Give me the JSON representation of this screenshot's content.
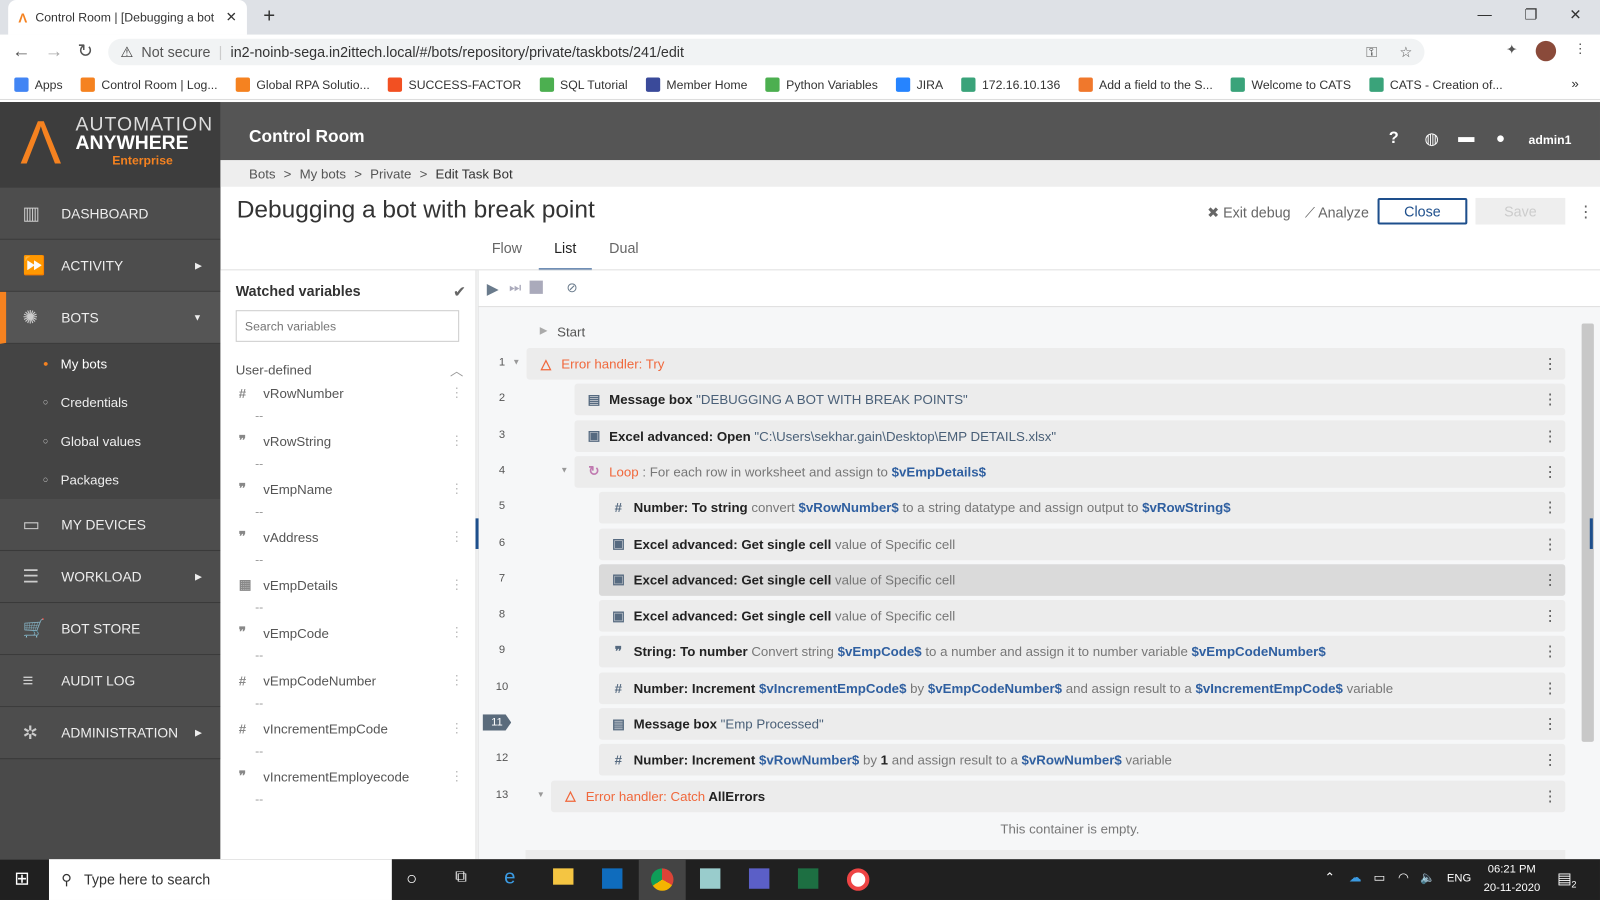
{
  "browser": {
    "tab_title": "Control Room | [Debugging a bot",
    "url_warning": "Not secure",
    "url": "in2-noinb-sega.in2ittech.local/#/bots/repository/private/taskbots/241/edit",
    "bookmarks": [
      {
        "label": "Apps",
        "color": "#4285f4"
      },
      {
        "label": "Control Room | Log...",
        "color": "#f58220"
      },
      {
        "label": "Global RPA Solutio...",
        "color": "#f58220"
      },
      {
        "label": "SUCCESS-FACTOR",
        "color": "#f25022"
      },
      {
        "label": "SQL Tutorial",
        "color": "#4caf50"
      },
      {
        "label": "Member Home",
        "color": "#3a4a9a"
      },
      {
        "label": "Python Variables",
        "color": "#4caf50"
      },
      {
        "label": "JIRA",
        "color": "#2684ff"
      },
      {
        "label": "172.16.10.136",
        "color": "#3aa37a"
      },
      {
        "label": "Add a field to the S...",
        "color": "#f0782c"
      },
      {
        "label": "Welcome to CATS",
        "color": "#3aa37a"
      },
      {
        "label": "CATS - Creation of...",
        "color": "#3aa37a"
      }
    ]
  },
  "app": {
    "logo_line1": "AUTOMATION",
    "logo_line2": "ANYWHERE",
    "logo_line3": "Enterprise",
    "header_title": "Control Room",
    "user": "admin1"
  },
  "nav": [
    {
      "label": "DASHBOARD",
      "icon": "dashboard-icon",
      "glyph": "▥"
    },
    {
      "label": "ACTIVITY",
      "icon": "activity-icon",
      "glyph": "⏩",
      "arrow": "▶"
    },
    {
      "label": "BOTS",
      "icon": "bots-icon",
      "glyph": "✺",
      "arrow": "▼",
      "active": true
    },
    {
      "label": "My bots",
      "sub": true,
      "active": true
    },
    {
      "label": "Credentials",
      "sub": true
    },
    {
      "label": "Global values",
      "sub": true
    },
    {
      "label": "Packages",
      "sub": true
    },
    {
      "label": "MY DEVICES",
      "icon": "devices-icon",
      "glyph": "▭"
    },
    {
      "label": "WORKLOAD",
      "icon": "workload-icon",
      "glyph": "☰",
      "arrow": "▶"
    },
    {
      "label": "BOT STORE",
      "icon": "bot-store-icon",
      "glyph": "🛒"
    },
    {
      "label": "AUDIT LOG",
      "icon": "audit-log-icon",
      "glyph": "≡"
    },
    {
      "label": "ADMINISTRATION",
      "icon": "administration-icon",
      "glyph": "✲",
      "arrow": "▶"
    }
  ],
  "breadcrumb": [
    "Bots",
    ">",
    "My bots",
    ">",
    "Private",
    ">",
    "Edit Task Bot"
  ],
  "page": {
    "title": "Debugging a bot with break point",
    "exit_debug": "Exit debug",
    "analyze": "Analyze",
    "close": "Close",
    "save": "Save",
    "tabs": [
      "Flow",
      "List",
      "Dual"
    ],
    "active_tab": "List"
  },
  "watched": {
    "title": "Watched variables",
    "search_placeholder": "Search variables",
    "section": "User-defined",
    "vars": [
      {
        "name": "vRowNumber",
        "type": "#",
        "value": "--"
      },
      {
        "name": "vRowString",
        "type": "❞",
        "value": "--"
      },
      {
        "name": "vEmpName",
        "type": "❞",
        "value": "--"
      },
      {
        "name": "vAddress",
        "type": "❞",
        "value": "--"
      },
      {
        "name": "vEmpDetails",
        "type": "▦",
        "value": "--"
      },
      {
        "name": "vEmpCode",
        "type": "❞",
        "value": "--"
      },
      {
        "name": "vEmpCodeNumber",
        "type": "#",
        "value": "--"
      },
      {
        "name": "vIncrementEmpCode",
        "type": "#",
        "value": "--"
      },
      {
        "name": "vIncrementEmployecode",
        "type": "❞",
        "value": "--"
      }
    ]
  },
  "list": {
    "start": "Start",
    "empty": "This container is empty.",
    "current_line": "11",
    "rows": [
      {
        "n": "1",
        "icon": "△",
        "ic": "#f0683c",
        "parts": [
          [
            "e",
            "Error handler: Try"
          ]
        ],
        "caret": true
      },
      {
        "n": "2",
        "icon": "▤",
        "parts": [
          [
            "b",
            "Message box"
          ],
          [
            "s",
            " \"DEBUGGING A BOT WITH BREAK POINTS\""
          ]
        ]
      },
      {
        "n": "3",
        "icon": "▣",
        "parts": [
          [
            "b",
            "Excel advanced: Open"
          ],
          [
            "s",
            " \"C:\\Users\\sekhar.gain\\Desktop\\EMP DETAILS.xlsx\""
          ]
        ]
      },
      {
        "n": "4",
        "icon": "↻",
        "ic": "#c07ab0",
        "parts": [
          [
            "e",
            "Loop"
          ],
          [
            "t",
            " : For each row in worksheet and assign to "
          ],
          [
            "v",
            "$vEmpDetails$"
          ]
        ],
        "caret": true
      },
      {
        "n": "5",
        "icon": "#",
        "parts": [
          [
            "b",
            "Number: To string"
          ],
          [
            "t",
            " convert "
          ],
          [
            "v",
            "$vRowNumber$"
          ],
          [
            "t",
            " to a string datatype and assign output to "
          ],
          [
            "v",
            "$vRowString$"
          ]
        ]
      },
      {
        "n": "6",
        "icon": "▣",
        "parts": [
          [
            "b",
            "Excel advanced: Get single cell"
          ],
          [
            "t",
            " value of Specific cell"
          ]
        ]
      },
      {
        "n": "7",
        "icon": "▣",
        "parts": [
          [
            "b",
            "Excel advanced: Get single cell"
          ],
          [
            "t",
            " value of Specific cell"
          ]
        ],
        "selected": true
      },
      {
        "n": "8",
        "icon": "▣",
        "parts": [
          [
            "b",
            "Excel advanced: Get single cell"
          ],
          [
            "t",
            " value of Specific cell"
          ]
        ]
      },
      {
        "n": "9",
        "icon": "❞",
        "parts": [
          [
            "b",
            "String: To number"
          ],
          [
            "t",
            " Convert string "
          ],
          [
            "v",
            "$vEmpCode$"
          ],
          [
            "t",
            " to a number and assign it to number variable "
          ],
          [
            "v",
            "$vEmpCodeNumber$"
          ]
        ]
      },
      {
        "n": "10",
        "icon": "#",
        "parts": [
          [
            "b",
            "Number: Increment"
          ],
          [
            "t",
            " "
          ],
          [
            "v",
            "$vIncrementEmpCode$"
          ],
          [
            "t",
            " by "
          ],
          [
            "v",
            "$vEmpCodeNumber$"
          ],
          [
            "t",
            " and assign result to a "
          ],
          [
            "v",
            "$vIncrementEmpCode$"
          ],
          [
            "t",
            " variable"
          ]
        ]
      },
      {
        "n": "11",
        "icon": "▤",
        "parts": [
          [
            "b",
            "Message box"
          ],
          [
            "s",
            " \"Emp Processed\""
          ]
        ],
        "breakpoint": true
      },
      {
        "n": "12",
        "icon": "#",
        "parts": [
          [
            "b",
            "Number: Increment"
          ],
          [
            "t",
            " "
          ],
          [
            "v",
            "$vRowNumber$"
          ],
          [
            "t",
            " by "
          ],
          [
            "b",
            "1"
          ],
          [
            "t",
            " and assign result to a "
          ],
          [
            "v",
            "$vRowNumber$"
          ],
          [
            "t",
            " variable"
          ]
        ]
      },
      {
        "n": "13",
        "icon": "△",
        "ic": "#f0683c",
        "parts": [
          [
            "e",
            "Error handler: Catch"
          ],
          [
            "b",
            " AllErrors"
          ]
        ],
        "caret": true
      }
    ]
  },
  "taskbar": {
    "search": "Type here to search",
    "time": "06:21 PM",
    "date": "20-11-2020",
    "lang": "ENG",
    "notif": "2"
  }
}
